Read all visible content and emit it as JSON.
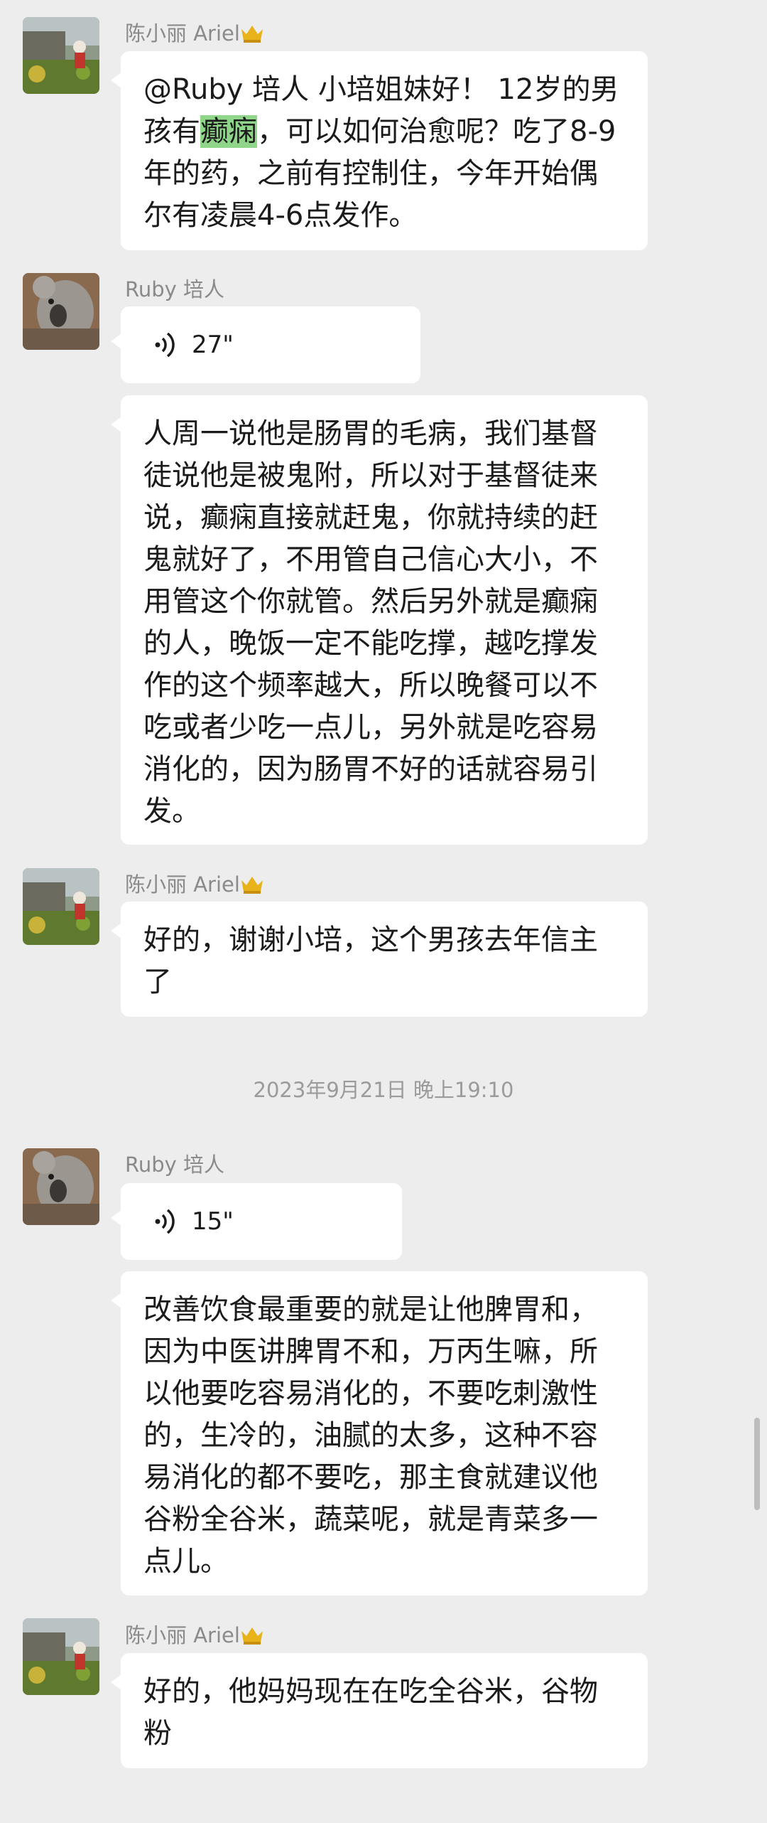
{
  "chat": {
    "messages": [
      {
        "sender": "陈小丽 Ariel",
        "sender_badge": "crown-icon",
        "text_before": "@Ruby 培人 小培姐妹好！ 12岁的男孩有",
        "text_highlight": "癫痫",
        "text_after": "，可以如何治愈呢？吃了8-9年的药，之前有控制住，今年开始偶尔有凌晨4-6点发作。"
      },
      {
        "sender": "Ruby 培人",
        "voice_duration": "27\"",
        "text": "人周一说他是肠胃的毛病，我们基督徒说他是被鬼附，所以对于基督徒来说，癫痫直接就赶鬼，你就持续的赶鬼就好了，不用管自己信心大小，不用管这个你就管。然后另外就是癫痫的人，晚饭一定不能吃撑，越吃撑发作的这个频率越大，所以晚餐可以不吃或者少吃一点儿，另外就是吃容易消化的，因为肠胃不好的话就容易引发。"
      },
      {
        "sender": "陈小丽 Ariel",
        "sender_badge": "crown-icon",
        "text": "好的，谢谢小培，这个男孩去年信主了"
      },
      {
        "sender": "Ruby 培人",
        "voice_duration": "15\"",
        "text": "改善饮食最重要的就是让他脾胃和，因为中医讲脾胃不和，万丙生嘛，所以他要吃容易消化的，不要吃刺激性的，生冷的，油腻的太多，这种不容易消化的都不要吃，那主食就建议他谷粉全谷米，蔬菜呢，就是青菜多一点儿。"
      },
      {
        "sender": "陈小丽 Ariel",
        "sender_badge": "crown-icon",
        "text": "好的，他妈妈现在在吃全谷米，谷物粉"
      }
    ],
    "timestamp": "2023年9月21日 晚上19:10"
  },
  "colors": {
    "background": "#ededed",
    "bubble": "#ffffff",
    "highlight": "#8fd68a",
    "name_text": "#8a8a8a",
    "crown": "#e8b21b"
  }
}
